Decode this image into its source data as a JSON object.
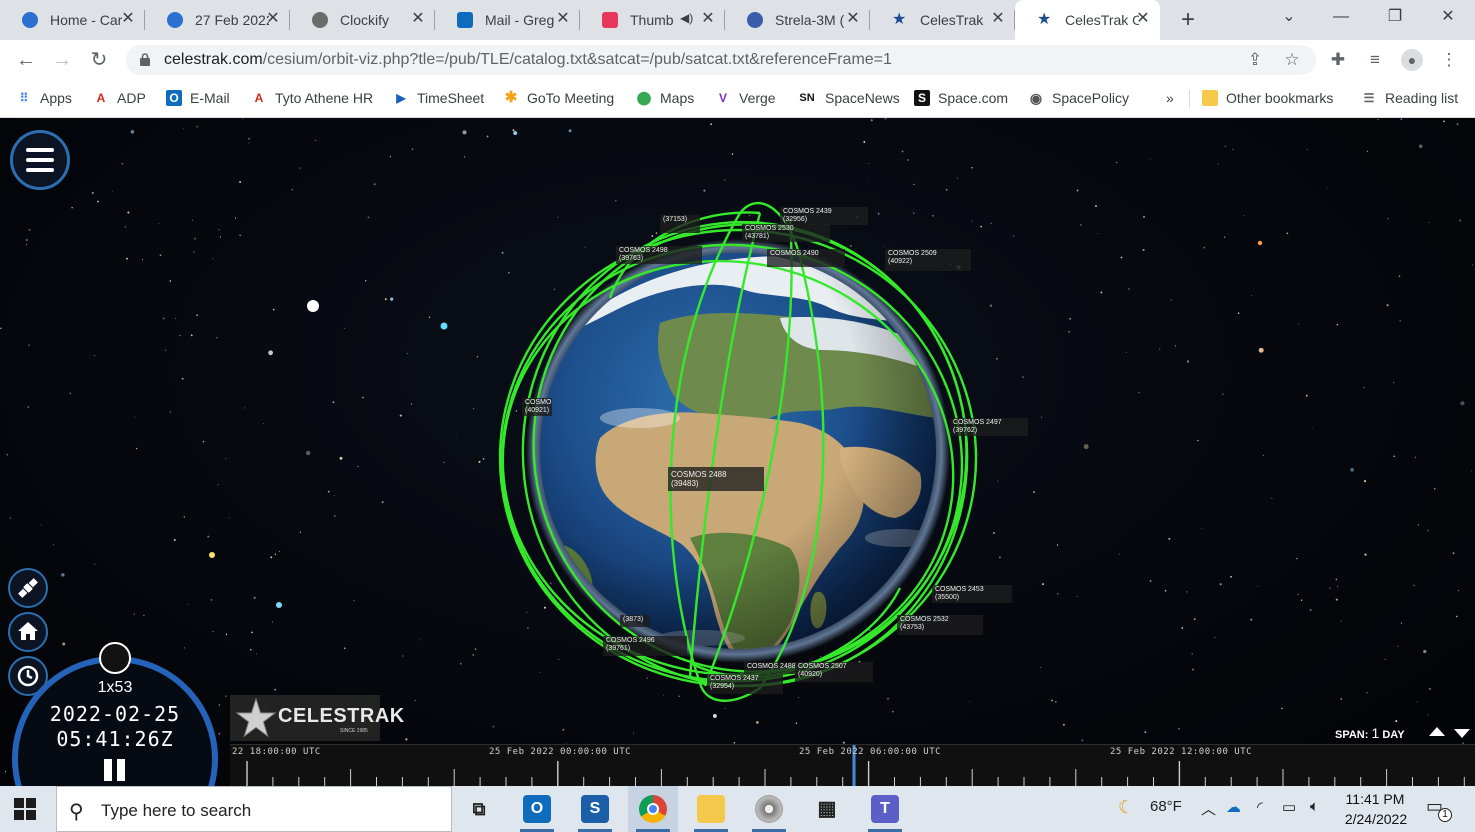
{
  "browser": {
    "tabs": [
      {
        "title": "Home - Car",
        "color": "#2c6fd1"
      },
      {
        "title": "27 Feb 2022",
        "color": "#2c6fd1"
      },
      {
        "title": "Clockify",
        "color": "#6b6b6b"
      },
      {
        "title": "Mail - Greg",
        "color": "#0f6cbd"
      },
      {
        "title": "Thumb",
        "color": "#e8385a"
      },
      {
        "title": "Strela-3M (",
        "color": "#3b5dab"
      },
      {
        "title": "CelesTrak",
        "color": "#1d4c8f"
      },
      {
        "title": "CelesTrak O",
        "color": "#1d4c8f"
      }
    ],
    "url_host": "celestrak.com",
    "url_path": "/cesium/orbit-viz.php?tle=/pub/TLE/catalog.txt&satcat=/pub/satcat.txt&referenceFrame=1",
    "bookmarks": [
      {
        "label": "Apps",
        "icon": "apps-icon",
        "color": "#4285f4",
        "glyph": "⋮⋮"
      },
      {
        "label": "ADP",
        "icon": "adp-icon",
        "color": "#d0271d",
        "glyph": "A"
      },
      {
        "label": "E-Mail",
        "icon": "outlook-icon",
        "color": "#0f6cbd",
        "glyph": "O"
      },
      {
        "label": "Tyto Athene HR",
        "icon": "adp-icon",
        "color": "#d0271d",
        "glyph": "A"
      },
      {
        "label": "TimeSheet",
        "icon": "timesheet-icon",
        "color": "#1c5fb8",
        "glyph": "▶"
      },
      {
        "label": "GoTo Meeting",
        "icon": "goto-icon",
        "color": "#f2a31b",
        "glyph": "✱"
      },
      {
        "label": "Maps",
        "icon": "maps-pin-icon",
        "color": "#34a853",
        "glyph": "⬤"
      },
      {
        "label": "Verge",
        "icon": "verge-icon",
        "color": "#7b2cbf",
        "glyph": "V"
      },
      {
        "label": "SpaceNews",
        "icon": "spacenews-icon",
        "color": "#c8102e",
        "glyph": "SN"
      },
      {
        "label": "Space.com",
        "icon": "space-com-icon",
        "color": "#111111",
        "glyph": "S"
      },
      {
        "label": "SpacePolicy",
        "icon": "spacepolicy-icon",
        "color": "#555555",
        "glyph": "◉"
      }
    ],
    "more_bookmarks": "»",
    "other_bookmarks": "Other bookmarks",
    "reading_list": "Reading list"
  },
  "viewer": {
    "satellites": [
      {
        "name": "COSMOS 2439",
        "id": "(32956)"
      },
      {
        "name": "COSMOS 2530",
        "id": "(43781)"
      },
      {
        "name": "",
        "id": "(37153)"
      },
      {
        "name": "COSMOS 2498",
        "id": "(39763)"
      },
      {
        "name": "COSMOS 2490",
        "id": ""
      },
      {
        "name": "COSMOS 2509",
        "id": "(40922)"
      },
      {
        "name": "COSMO",
        "id": "(40921)"
      },
      {
        "name": "COSMOS 2497",
        "id": "(39762)"
      },
      {
        "name": "COSMOS 2488",
        "id": "(39483)"
      },
      {
        "name": "COSMOS 2453",
        "id": "(35500)"
      },
      {
        "name": "COSMOS 2532",
        "id": "(43753)"
      },
      {
        "name": "COSMOS 2496",
        "id": "(39761)"
      },
      {
        "name": "",
        "id": "(3873)"
      },
      {
        "name": "COSMOS 2437",
        "id": "(32954)"
      },
      {
        "name": "COSMOS 2488",
        "id": ""
      },
      {
        "name": "COSMOS 2507",
        "id": "(40920)"
      }
    ],
    "clock": {
      "speed": "1x53",
      "date": "2022-02-25",
      "time": "05:41:26Z"
    },
    "logo": {
      "text": "CELESTRAK",
      "since": "SINCE 1985"
    },
    "span": {
      "prefix": "SPAN:",
      "value": "1",
      "unit": "DAY"
    },
    "timeline": {
      "labels": [
        "22 18:00:00 UTC",
        "25 Feb 2022 00:00:00 UTC",
        "25 Feb 2022 06:00:00 UTC",
        "25 Feb 2022 12:00:00 UTC"
      ]
    },
    "orbit_color": "#36e82c"
  },
  "taskbar": {
    "search_placeholder": "Type here to search",
    "weather": "68°F",
    "time": "11:41 PM",
    "date": "2/24/2022",
    "notifications": "1",
    "apps": [
      {
        "name": "task-view-icon"
      },
      {
        "name": "outlook-icon"
      },
      {
        "name": "sametime-icon"
      },
      {
        "name": "chrome-icon"
      },
      {
        "name": "file-explorer-icon"
      },
      {
        "name": "disk-pro-icon"
      },
      {
        "name": "calculator-icon"
      },
      {
        "name": "teams-icon"
      }
    ]
  }
}
